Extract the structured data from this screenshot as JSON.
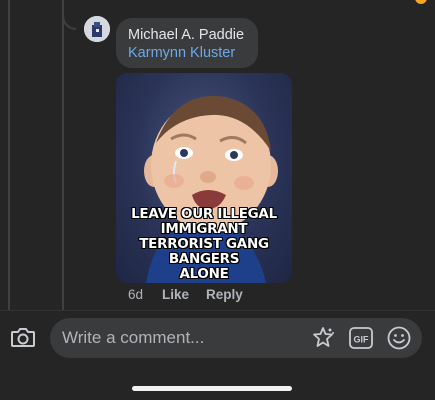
{
  "comment": {
    "author": "Michael A. Paddie",
    "mention": "Karmynn Kluster",
    "meme_caption": [
      "LEAVE OUR ILLEGAL",
      "IMMIGRANT",
      "TERRORIST GANG BANGERS",
      "ALONE"
    ],
    "time": "6d",
    "like_label": "Like",
    "reply_label": "Reply"
  },
  "composer": {
    "placeholder": "Write a comment...",
    "icons": [
      "camera-icon",
      "avatar-sticker-icon",
      "gif-icon",
      "emoji-icon"
    ]
  },
  "colors": {
    "background": "#252526",
    "bubble": "#3a3b3c",
    "mention": "#6ea9e8",
    "secondary_text": "#b0b3b8"
  }
}
